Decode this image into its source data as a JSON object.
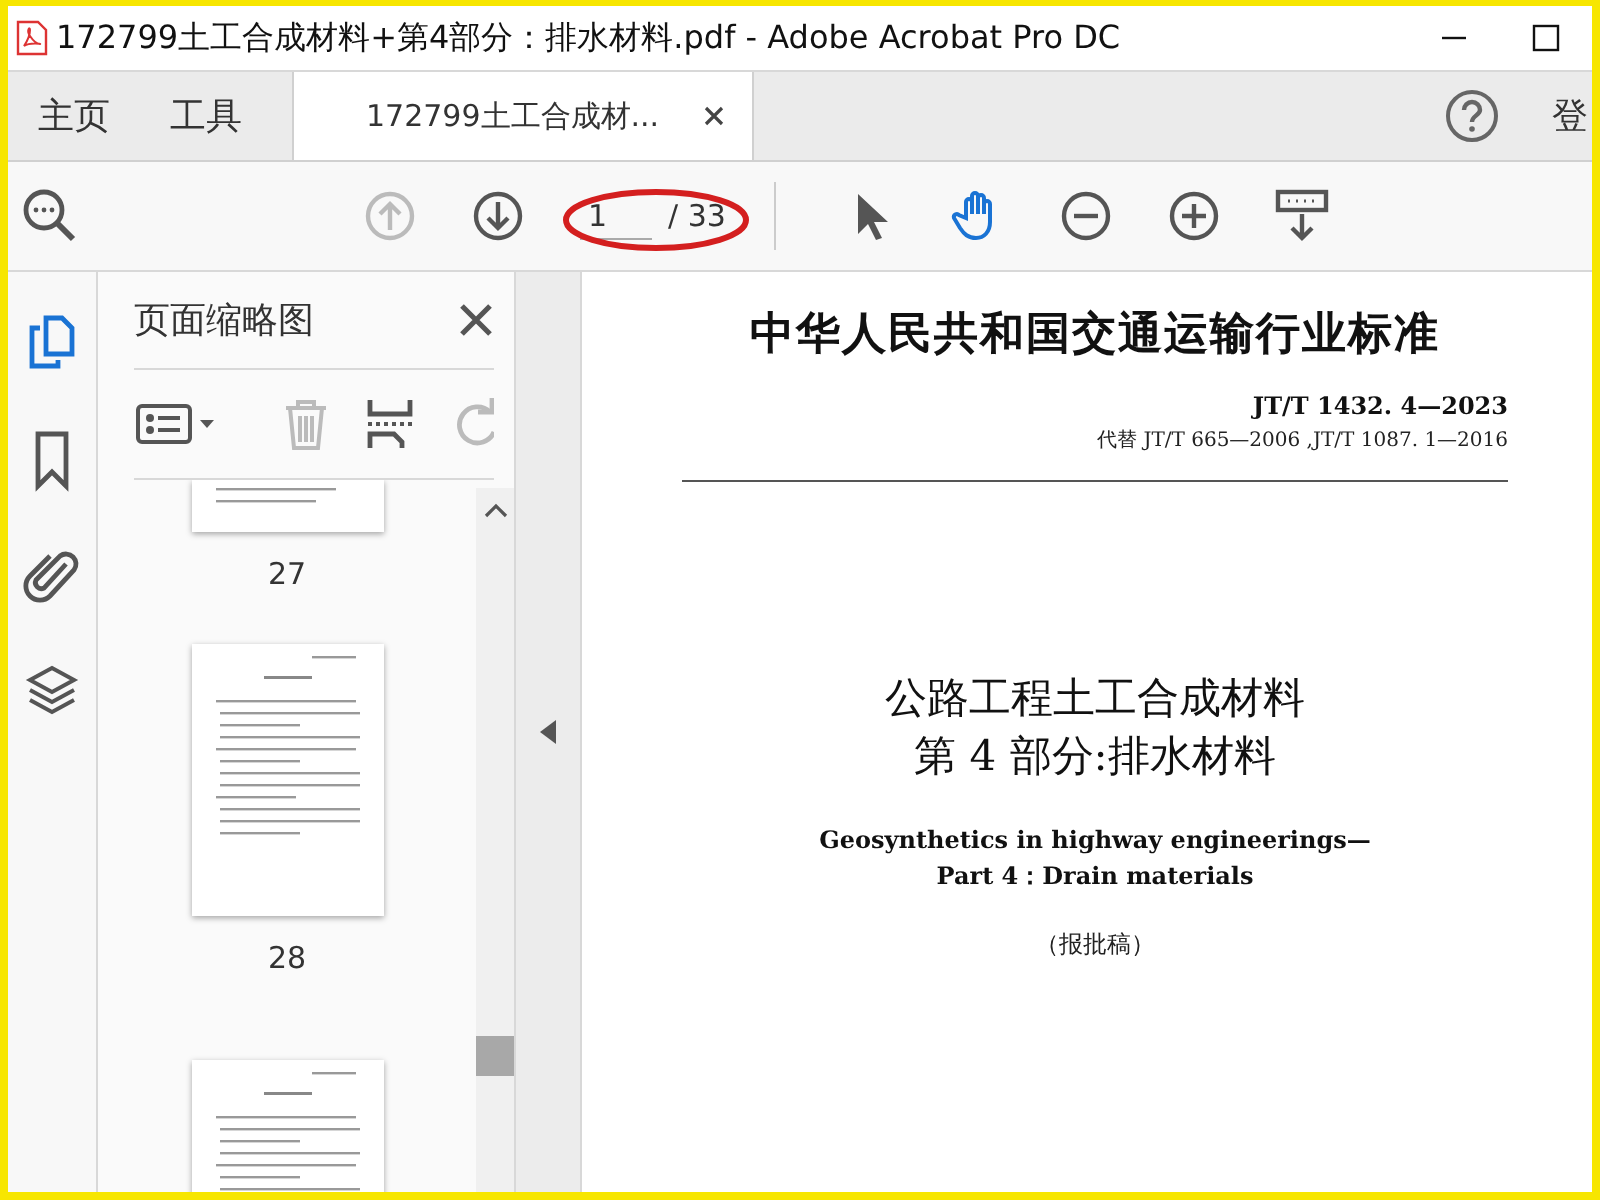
{
  "window": {
    "title": "172799土工合成材料+第4部分：排水材料.pdf - Adobe Acrobat Pro DC"
  },
  "tabs": [
    {
      "label": "主页",
      "selected": false
    },
    {
      "label": "工具",
      "selected": false
    },
    {
      "label": "172799土工合成材...",
      "selected": true
    }
  ],
  "account": {
    "label": "登"
  },
  "toolbar": {
    "nav": [
      {
        "kind": "prev",
        "disabled": true
      },
      {
        "kind": "next",
        "disabled": false
      }
    ],
    "page_current": "1",
    "page_total": "/ 33",
    "tools": [
      {
        "kind": "select",
        "selected": false
      },
      {
        "kind": "hand",
        "selected": true
      },
      {
        "kind": "zoom_out",
        "selected": false
      },
      {
        "kind": "zoom_in",
        "selected": false
      },
      {
        "kind": "keyboard",
        "selected": false
      }
    ]
  },
  "rail": [
    {
      "kind": "pages",
      "selected": true
    },
    {
      "kind": "bookmarks",
      "selected": false
    },
    {
      "kind": "attachments",
      "selected": false
    },
    {
      "kind": "layers",
      "selected": false
    }
  ],
  "panel": {
    "title": "页面缩略图",
    "tools": [
      {
        "kind": "options",
        "disabled": false
      },
      {
        "kind": "delete",
        "disabled": true
      },
      {
        "kind": "insert",
        "disabled": false
      },
      {
        "kind": "rotate",
        "disabled": true
      }
    ],
    "thumbnails": [
      {
        "kind": "cut_top",
        "label": "27"
      },
      {
        "kind": "full",
        "label": "28"
      },
      {
        "kind": "cut_bottom"
      }
    ]
  },
  "document": {
    "heading": "中华人民共和国交通运输行业标准",
    "code": "JT/T  1432. 4—2023",
    "replaces": "代替 JT/T 665—2006 ,JT/T 1087. 1—2016",
    "title_lines": [
      "公路工程土工合成材料",
      "第 4 部分:排水材料"
    ],
    "english_lines": [
      "Geosynthetics in highway engineerings—",
      "Part 4：Drain materials"
    ],
    "draft_note": "（报批稿）"
  }
}
